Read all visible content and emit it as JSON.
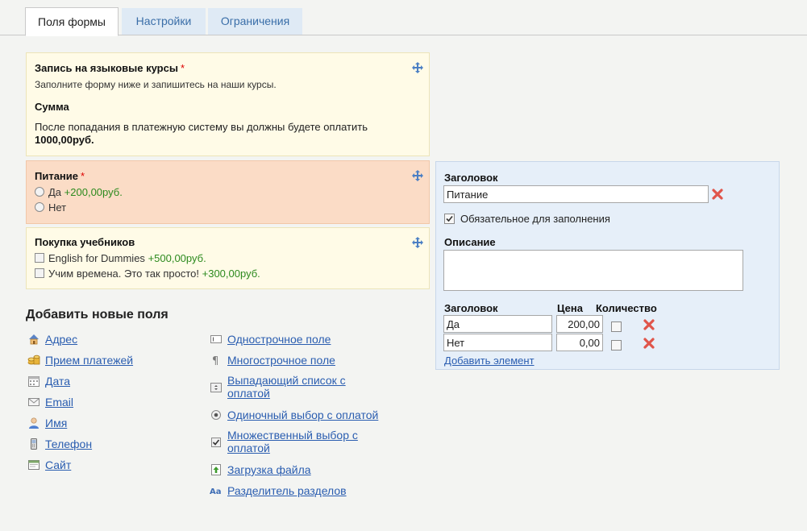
{
  "tabs": [
    {
      "label": "Поля формы"
    },
    {
      "label": "Настройки"
    },
    {
      "label": "Ограничения"
    }
  ],
  "form_header": {
    "title": "Запись на языковые курсы",
    "required_mark": "*",
    "description": "Заполните форму ниже и запишитесь на наши курсы.",
    "sum_label": "Сумма",
    "payment_text": "После попадания в платежную систему вы должны будете оплатить",
    "payment_amount": "1000,00руб."
  },
  "fields": [
    {
      "title": "Питание",
      "required_mark": "*",
      "options": [
        {
          "label": "Да",
          "price": "+200,00руб."
        },
        {
          "label": "Нет",
          "price": ""
        }
      ]
    },
    {
      "title": "Покупка учебников",
      "options": [
        {
          "label": "English for Dummies",
          "price": "+500,00руб."
        },
        {
          "label": "Учим времена. Это так просто!",
          "price": "+300,00руб."
        }
      ]
    }
  ],
  "add_fields": {
    "title": "Добавить новые поля",
    "left": [
      {
        "label": "Адрес",
        "icon": "house-icon"
      },
      {
        "label": "Прием платежей",
        "icon": "coins-icon"
      },
      {
        "label": "Дата",
        "icon": "calendar-icon"
      },
      {
        "label": "Email",
        "icon": "envelope-icon"
      },
      {
        "label": "Имя",
        "icon": "user-icon"
      },
      {
        "label": "Телефон",
        "icon": "phone-icon"
      },
      {
        "label": "Сайт",
        "icon": "browser-icon"
      }
    ],
    "right": [
      {
        "label": "Однострочное поле",
        "icon": "text-field-icon"
      },
      {
        "label": "Многострочное поле",
        "icon": "paragraph-icon"
      },
      {
        "label": "Выпадающий список с оплатой",
        "icon": "dropdown-icon"
      },
      {
        "label": "Одиночный выбор с оплатой",
        "icon": "radio-icon"
      },
      {
        "label": "Множественный выбор с оплатой",
        "icon": "checkbox-icon"
      },
      {
        "label": "Загрузка файла",
        "icon": "upload-icon"
      },
      {
        "label": "Разделитель разделов",
        "icon": "section-divider-icon"
      }
    ]
  },
  "editor": {
    "title_label": "Заголовок",
    "title_value": "Питание",
    "required_label": "Обязательное для заполнения",
    "required_checked": true,
    "description_label": "Описание",
    "description_value": "",
    "columns": {
      "title": "Заголовок",
      "price": "Цена",
      "quantity": "Количество"
    },
    "items": [
      {
        "title": "Да",
        "price": "200,00"
      },
      {
        "title": "Нет",
        "price": "0,00"
      }
    ],
    "add_item": "Добавить элемент"
  },
  "colors": {
    "accent_link": "#2a5db0",
    "price_green": "#2c8a1e",
    "required_red": "#dd0000",
    "selected_block": "#fbdcc6",
    "editor_bg": "#e6eff9"
  }
}
